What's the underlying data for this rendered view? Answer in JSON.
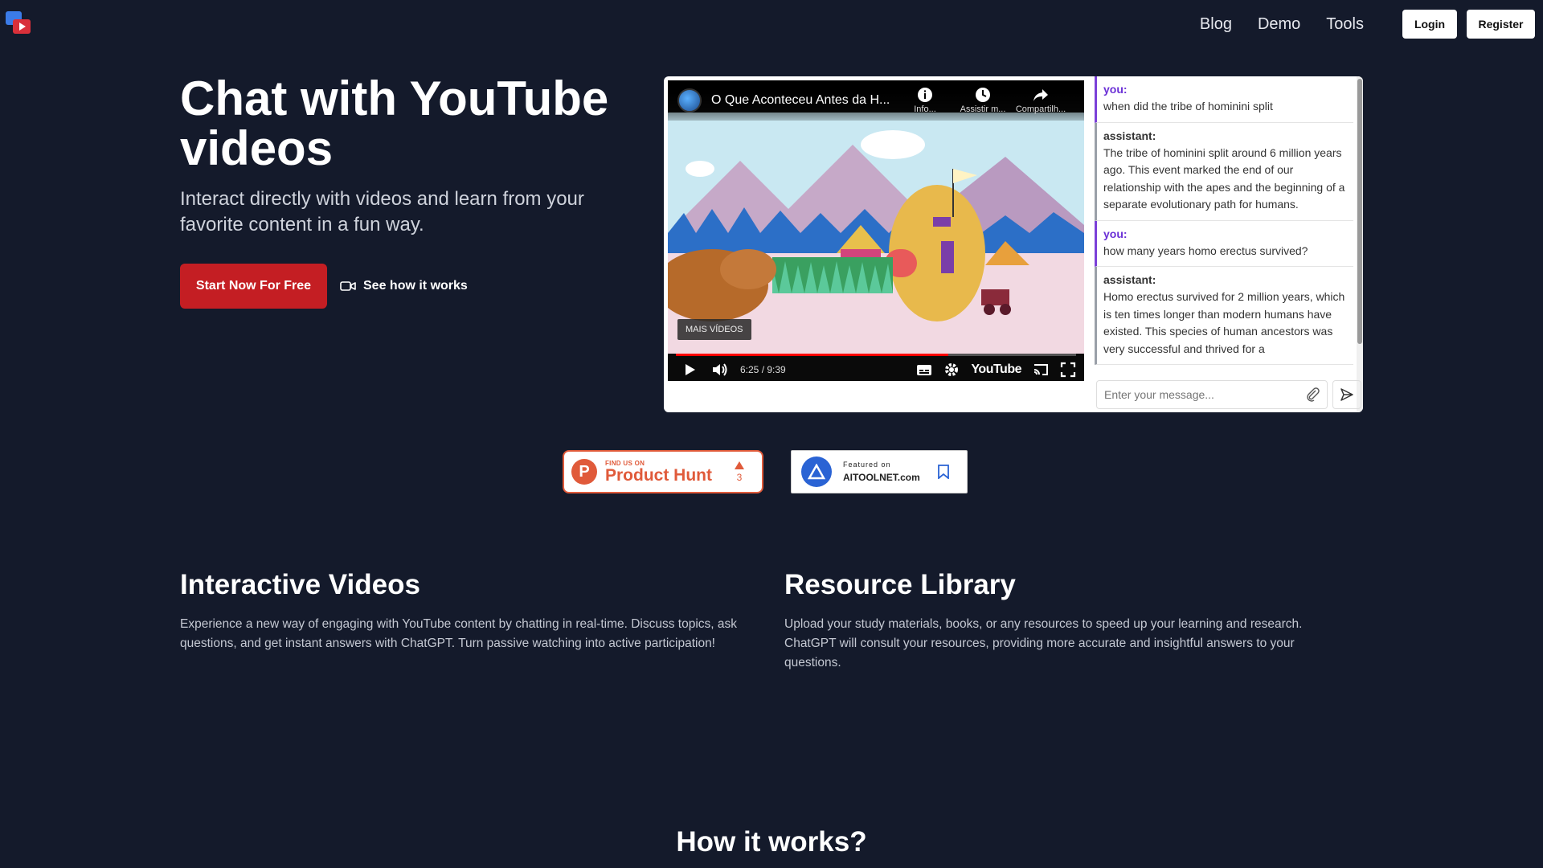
{
  "nav": {
    "links": [
      "Blog",
      "Demo",
      "Tools"
    ],
    "login": "Login",
    "register": "Register"
  },
  "hero": {
    "title": "Chat with YouTube videos",
    "subtitle": "Interact directly with videos and learn from your favorite content in a fun way.",
    "cta": "Start Now For Free",
    "secondary": "See how it works"
  },
  "video": {
    "title": "O Que Aconteceu Antes da H...",
    "actions": [
      "Info...",
      "Assistir m...",
      "Compartilh..."
    ],
    "more_videos": "MAIS VÍDEOS",
    "time": "6:25 / 9:39",
    "progress": 0.68,
    "youtube_label": "YouTube"
  },
  "chat": {
    "messages": [
      {
        "role": "you:",
        "text": "when did the tribe of hominini split",
        "kind": "user"
      },
      {
        "role": "assistant:",
        "text": "The tribe of hominini split around 6 million years ago. This event marked the end of our relationship with the apes and the beginning of a separate evolutionary path for humans.",
        "kind": "assistant"
      },
      {
        "role": "you:",
        "text": "how many years homo erectus survived?",
        "kind": "user"
      },
      {
        "role": "assistant:",
        "text": "Homo erectus survived for 2 million years, which is ten times longer than modern humans have existed. This species of human ancestors was very successful and thrived for a",
        "kind": "assistant"
      }
    ],
    "placeholder": "Enter your message..."
  },
  "badges": {
    "producthunt": {
      "small": "FIND US ON",
      "big": "Product Hunt",
      "votes": "3"
    },
    "aitoolnet": {
      "small": "Featured on",
      "big": "AITOOLNET.com"
    }
  },
  "features": [
    {
      "title": "Interactive Videos",
      "text": "Experience a new way of engaging with YouTube content by chatting in real-time. Discuss topics, ask questions, and get instant answers with ChatGPT. Turn passive watching into active participation!"
    },
    {
      "title": "Resource Library",
      "text": "Upload your study materials, books, or any resources to speed up your learning and research. ChatGPT will consult your resources, providing more accurate and insightful answers to your questions."
    }
  ],
  "how_it_works": "How it works?"
}
